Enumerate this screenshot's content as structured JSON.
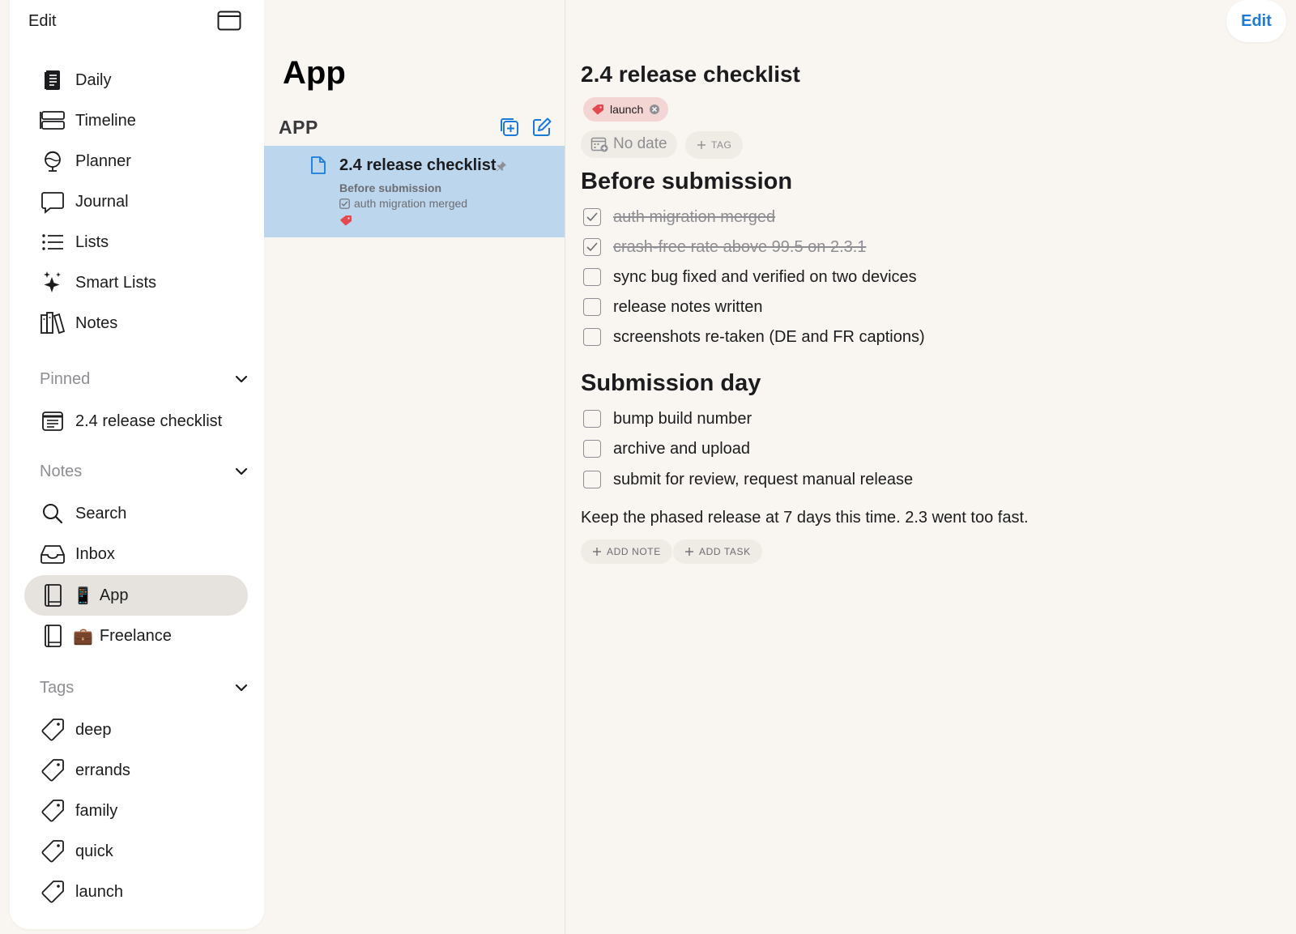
{
  "sidebar": {
    "edit_label": "Edit",
    "nav": [
      {
        "label": "Daily",
        "icon": "journal-book-icon"
      },
      {
        "label": "Timeline",
        "icon": "timeline-icon"
      },
      {
        "label": "Planner",
        "icon": "planner-icon"
      },
      {
        "label": "Journal",
        "icon": "speech-bubble-icon"
      },
      {
        "label": "Lists",
        "icon": "list-icon"
      },
      {
        "label": "Smart Lists",
        "icon": "sparkles-icon"
      },
      {
        "label": "Notes",
        "icon": "books-icon"
      }
    ],
    "pinned": {
      "title": "Pinned",
      "items": [
        {
          "label": "2.4 release checklist",
          "icon": "note-card-icon"
        }
      ]
    },
    "notes": {
      "title": "Notes",
      "items": [
        {
          "label": "Search",
          "icon": "search-icon"
        },
        {
          "label": "Inbox",
          "icon": "inbox-icon"
        },
        {
          "label": "App",
          "emoji": "📱",
          "icon": "notebook-icon",
          "selected": true
        },
        {
          "label": "Freelance",
          "emoji": "💼",
          "icon": "notebook-icon"
        }
      ]
    },
    "tags": {
      "title": "Tags",
      "items": [
        {
          "label": "deep"
        },
        {
          "label": "errands"
        },
        {
          "label": "family"
        },
        {
          "label": "quick"
        },
        {
          "label": "launch"
        }
      ]
    }
  },
  "list": {
    "title": "App",
    "notebook_label": "APP",
    "notes": [
      {
        "title": "2.4 release checklist",
        "subtitle": "Before submission",
        "preview": "auth migration merged",
        "pinned": true,
        "tag_color": "#e5484d"
      }
    ]
  },
  "detail": {
    "edit_label": "Edit",
    "title": "2.4 release checklist",
    "tags": [
      {
        "label": "launch",
        "color": "#e5484d"
      }
    ],
    "date_label": "No date",
    "tag_button": "TAG",
    "sections": [
      {
        "heading": "Before submission",
        "tasks": [
          {
            "text": "auth migration merged",
            "done": true
          },
          {
            "text": "crash-free rate above 99.5 on 2.3.1",
            "done": true
          },
          {
            "text": "sync bug fixed and verified on two devices",
            "done": false
          },
          {
            "text": "release notes written",
            "done": false
          },
          {
            "text": "screenshots re-taken (DE and FR captions)",
            "done": false
          }
        ]
      },
      {
        "heading": "Submission day",
        "tasks": [
          {
            "text": "bump build number",
            "done": false
          },
          {
            "text": "archive and upload",
            "done": false
          },
          {
            "text": "submit for review, request manual release",
            "done": false
          }
        ]
      }
    ],
    "note_text": "Keep the phased release at 7 days this time. 2.3 went too fast.",
    "add_note_label": "ADD NOTE",
    "add_task_label": "ADD TASK"
  },
  "colors": {
    "accent": "#1a7cd8",
    "selected_note_bg": "#bcd6ed",
    "tag_red": "#e5484d",
    "background": "#f9f5f0"
  }
}
